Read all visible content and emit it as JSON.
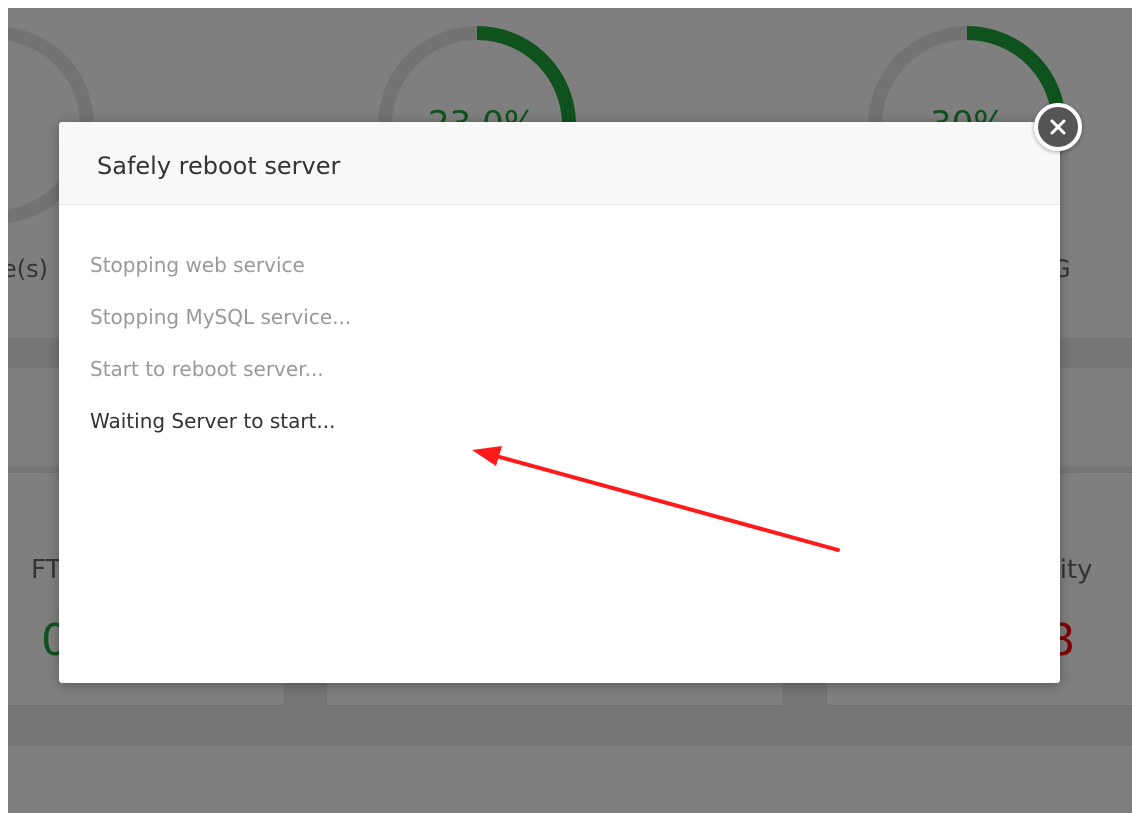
{
  "dashboard": {
    "gauges": [
      {
        "percent": "",
        "caption": "e(s)",
        "ring_color": "#cccccc",
        "fill_fraction": 0
      },
      {
        "percent": "23.0%",
        "caption": "",
        "ring_color": "#20a53a",
        "fill_fraction": 0.23
      },
      {
        "percent": "30%",
        "caption": "G",
        "ring_color": "#20a53a",
        "fill_fraction": 0.3
      }
    ],
    "cards": [
      {
        "label": "FT",
        "value": "0",
        "value_color": "#20a53a"
      },
      {
        "label": "",
        "value": "",
        "value_color": "#20a53a"
      },
      {
        "label": "rity",
        "value": "8",
        "value_color": "#ff0000"
      }
    ]
  },
  "modal": {
    "title": "Safely reboot server",
    "steps": [
      {
        "text": "Stopping web service",
        "state": "done"
      },
      {
        "text": "Stopping MySQL service...",
        "state": "done"
      },
      {
        "text": "Start to reboot server...",
        "state": "done"
      },
      {
        "text": "Waiting Server to start...",
        "state": "active"
      }
    ],
    "close_icon": "close-icon"
  },
  "annotation": {
    "arrow_color": "#ff1a1a",
    "arrow_icon": "red-arrow-icon"
  }
}
